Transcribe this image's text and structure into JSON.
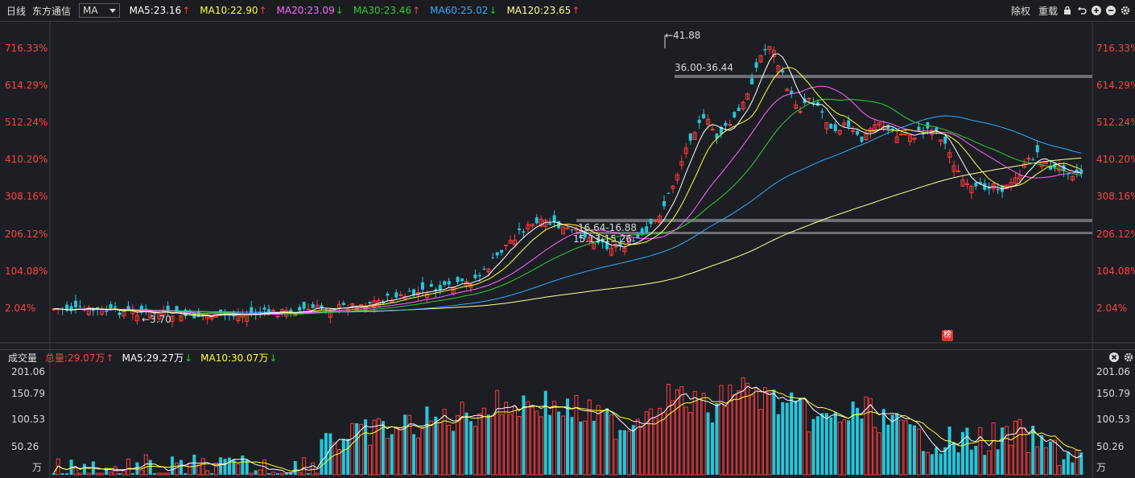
{
  "topbar": {
    "period": "日线",
    "stock_name": "东方通信",
    "indicator_select": "MA",
    "ma": [
      {
        "label": "MA5:23.16",
        "dir": "up",
        "color": "#ffffff"
      },
      {
        "label": "MA10:22.90",
        "dir": "up",
        "color": "#ffff33"
      },
      {
        "label": "MA20:23.09",
        "dir": "down",
        "color": "#ff66ff"
      },
      {
        "label": "MA30:23.46",
        "dir": "up",
        "color": "#33cc33"
      },
      {
        "label": "MA60:25.02",
        "dir": "down",
        "color": "#33aaff"
      },
      {
        "label": "MA120:23.65",
        "dir": "up",
        "color": "#ffff99"
      }
    ],
    "tools": {
      "exright": "除权",
      "reload": "重载"
    },
    "tool_icons": [
      "lock-icon",
      "undo-icon",
      "zoom-in-icon",
      "zoom-out-icon",
      "settings-icon"
    ]
  },
  "price_axis": [
    "716.33%",
    "614.29%",
    "512.24%",
    "410.20%",
    "308.16%",
    "206.12%",
    "104.08%",
    "2.04%"
  ],
  "annotations": {
    "high": "←41.88",
    "range_top": "36.00-36.44",
    "range_mid1": "16.64-16.88",
    "range_mid2": "15.13-15.26",
    "low": "←3.70",
    "badge": "榜"
  },
  "volume_bar": {
    "title": "成交量",
    "total": "总量:29.07万",
    "ma5": "MA5:29.27万",
    "ma10": "MA10:30.07万"
  },
  "volume_axis": [
    "201.06",
    "150.79",
    "100.53",
    "50.26",
    "万"
  ],
  "colors": {
    "up": "#ff3b3b",
    "down": "#26c6da",
    "ma5": "#ffffff",
    "ma10": "#ffff33",
    "ma20": "#ff66ff",
    "ma30": "#33cc33",
    "ma60": "#33aaff",
    "ma120": "#ffff99"
  }
}
